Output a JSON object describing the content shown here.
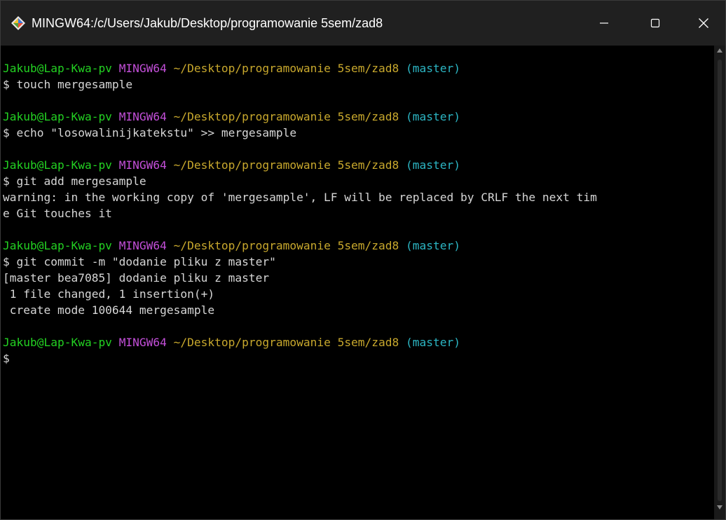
{
  "window": {
    "title": "MINGW64:/c/Users/Jakub/Desktop/programowanie 5sem/zad8",
    "app_icon": "git-diamond-icon",
    "controls": [
      "minimize-icon",
      "maximize-icon",
      "close-icon"
    ]
  },
  "colors": {
    "user": "#23d122",
    "system": "#c34fd9",
    "path": "#c8a82d",
    "branch": "#2cb6c4",
    "text": "#d6d6d6",
    "background": "#000000"
  },
  "prompt": {
    "user": "Jakub@Lap-Kwa-pv",
    "system": "MINGW64",
    "path": "~/Desktop/programowanie 5sem/zad8",
    "branch": "(master)",
    "symbol": "$"
  },
  "terminal": {
    "cmd1": "$ touch mergesample",
    "cmd2": "$ echo \"losowalinijkatekstu\" >> mergesample",
    "cmd3": "$ git add mergesample",
    "out3_1": "warning: in the working copy of 'mergesample', LF will be replaced by CRLF the next tim",
    "out3_2": "e Git touches it",
    "cmd4": "$ git commit -m \"dodanie pliku z master\"",
    "out4_1": "[master bea7085] dodanie pliku z master",
    "out4_2": " 1 file changed, 1 insertion(+)",
    "out4_3": " create mode 100644 mergesample",
    "cmd5": "$"
  }
}
